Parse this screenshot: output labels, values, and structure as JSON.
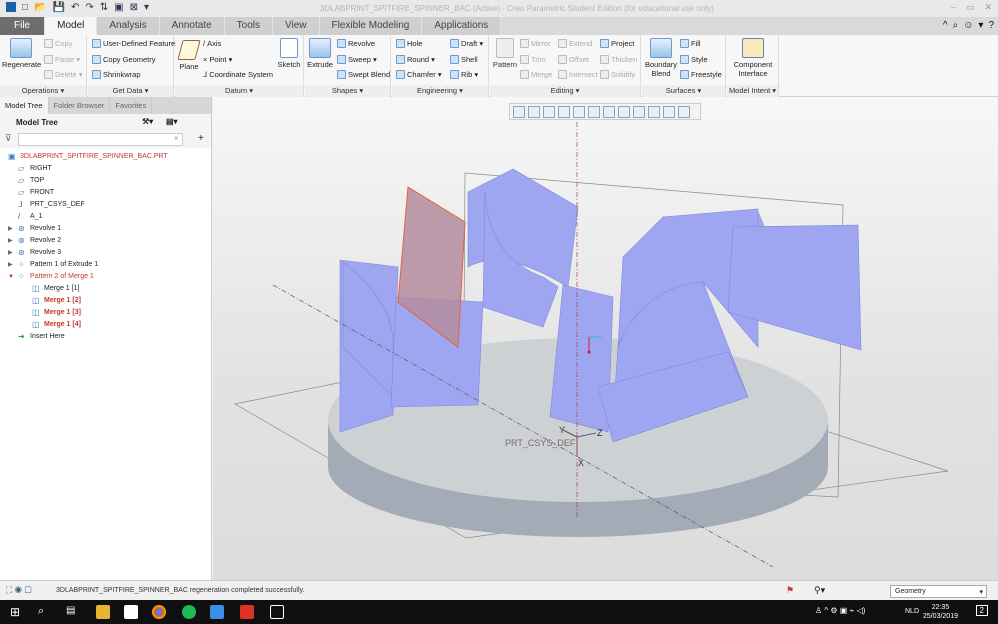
{
  "window": {
    "title": "3DLABPRINT_SPITFIRE_SPINNER_BAC (Active) - Creo Parametric Student Edition (for educational use only)",
    "controls": [
      "–",
      "▭",
      "✕"
    ]
  },
  "quick_access": [
    "□",
    "📂",
    "💾",
    "↶",
    "↷",
    "⇅",
    "▣",
    "⊠",
    "▾"
  ],
  "tabs": [
    "File",
    "Model",
    "Analysis",
    "Annotate",
    "Tools",
    "View",
    "Flexible Modeling",
    "Applications"
  ],
  "active_tab": "Model",
  "help_icons": [
    "^",
    "⌕",
    "☺",
    "▾",
    "?"
  ],
  "ribbon": {
    "operations": {
      "label": "Operations ▾",
      "regenerate": "Regenerate",
      "copy": "Copy",
      "paste": "Paste ▾",
      "delete": "Delete ▾"
    },
    "get_data": {
      "label": "Get Data ▾",
      "items": [
        "User-Defined Feature",
        "Copy Geometry",
        "Shrinkwrap"
      ]
    },
    "datum": {
      "label": "Datum ▾",
      "plane": "Plane",
      "axis": "Axis",
      "point": "Point ▾",
      "csys": "Coordinate System",
      "sketch": "Sketch"
    },
    "shapes": {
      "label": "Shapes ▾",
      "extrude": "Extrude",
      "revolve": "Revolve",
      "sweep": "Sweep ▾",
      "swept_blend": "Swept Blend"
    },
    "engineering": {
      "label": "Engineering ▾",
      "hole": "Hole",
      "round": "Round ▾",
      "chamfer": "Chamfer ▾",
      "draft": "Draft ▾",
      "shell": "Shell",
      "rib": "Rib ▾"
    },
    "editing": {
      "label": "Editing ▾",
      "pattern": "Pattern",
      "mirror": "Mirror",
      "trim": "Trim",
      "merge": "Merge",
      "extend": "Extend",
      "offset": "Offset",
      "intersect": "Intersect",
      "project": "Project",
      "thicken": "Thicken",
      "solidify": "Solidify"
    },
    "surfaces": {
      "label": "Surfaces ▾",
      "boundary_blend": "Boundary Blend",
      "fill": "Fill",
      "style": "Style",
      "freestyle": "Freestyle"
    },
    "model_intent": {
      "label": "Model Intent ▾",
      "component_interface": "Component Interface"
    }
  },
  "left_panel": {
    "tabs": [
      "Model Tree",
      "Folder Browser",
      "Favorites"
    ],
    "header": "Model Tree",
    "filter": {
      "value": "",
      "clear": "×"
    },
    "tree": [
      {
        "label": "3DLABPRINT_SPITFIRE_SPINNER_BAC.PRT",
        "level": 0,
        "style": "red",
        "icon": "part"
      },
      {
        "label": "RIGHT",
        "level": 1,
        "icon": "plane"
      },
      {
        "label": "TOP",
        "level": 1,
        "icon": "plane"
      },
      {
        "label": "FRONT",
        "level": 1,
        "icon": "plane"
      },
      {
        "label": "PRT_CSYS_DEF",
        "level": 1,
        "icon": "csys"
      },
      {
        "label": "A_1",
        "level": 1,
        "icon": "axis"
      },
      {
        "label": "Revolve 1",
        "level": 1,
        "icon": "revolve",
        "expand": "▶"
      },
      {
        "label": "Revolve 2",
        "level": 1,
        "icon": "revolve",
        "expand": "▶"
      },
      {
        "label": "Revolve 3",
        "level": 1,
        "icon": "revolve",
        "expand": "▶"
      },
      {
        "label": "Pattern 1 of Extrude 1",
        "level": 1,
        "icon": "pattern",
        "expand": "▶"
      },
      {
        "label": "Pattern 2 of Merge 1",
        "level": 1,
        "icon": "pattern",
        "expand": "▼",
        "style": "red"
      },
      {
        "label": "Merge 1 [1]",
        "level": 2,
        "icon": "merge"
      },
      {
        "label": "Merge 1 [2]",
        "level": 2,
        "icon": "merge",
        "style": "redb"
      },
      {
        "label": "Merge 1 [3]",
        "level": 2,
        "icon": "merge",
        "style": "redb"
      },
      {
        "label": "Merge 1 [4]",
        "level": 2,
        "icon": "merge",
        "style": "redb"
      },
      {
        "label": "Insert Here",
        "level": 1,
        "icon": "arrow"
      }
    ]
  },
  "graphics": {
    "csys_label": "PRT_CSYS_DEF",
    "axes": {
      "x": "X",
      "y": "Y",
      "z": "Z"
    },
    "colors": {
      "surface": "#9ea6f2",
      "base": "#aab3bd",
      "selected": "#b98a9a"
    }
  },
  "status": {
    "message": "3DLABPRINT_SPITFIRE_SPINNER_BAC regeneration completed successfully.",
    "filter": "Geometry"
  },
  "taskbar": {
    "time": "22:35",
    "date": "25/03/2019",
    "lang": "NLD",
    "notifications": "2"
  }
}
